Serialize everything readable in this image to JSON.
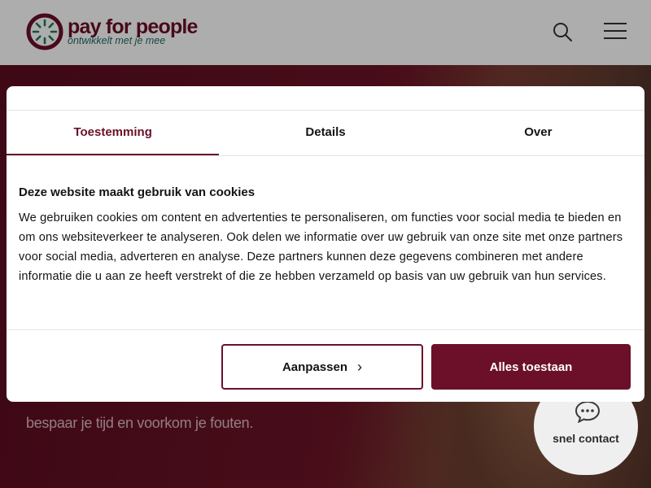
{
  "header": {
    "logo_name": "pay for people",
    "logo_tagline": "ontwikkelt met je mee"
  },
  "hero": {
    "text": "bespaar je tijd en voorkom je fouten."
  },
  "snel_contact": {
    "label": "snel contact"
  },
  "cookie_dialog": {
    "tabs": [
      {
        "label": "Toestemming",
        "active": true
      },
      {
        "label": "Details",
        "active": false
      },
      {
        "label": "Over",
        "active": false
      }
    ],
    "title": "Deze website maakt gebruik van cookies",
    "body": "We gebruiken cookies om content en advertenties te personaliseren, om functies voor social media te bieden en om ons websiteverkeer te analyseren. Ook delen we informatie over uw gebruik van onze site met onze partners voor social media, adverteren en analyse. Deze partners kunnen deze gegevens combineren met andere informatie die u aan ze heeft verstrekt of die ze hebben verzameld op basis van uw gebruik van hun services.",
    "customize_label": "Aanpassen",
    "accept_label": "Alles toestaan"
  },
  "colors": {
    "brand": "#6b1028",
    "tagline": "#1f6a5f"
  }
}
